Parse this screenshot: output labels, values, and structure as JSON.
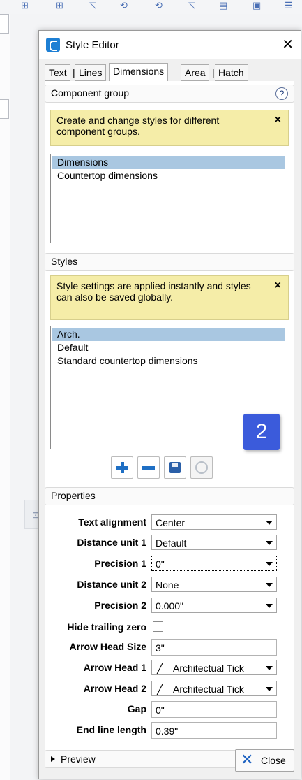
{
  "dialog": {
    "title": "Style Editor",
    "close_glyph": "✕"
  },
  "tabs": [
    {
      "label": "Text"
    },
    {
      "label": "Lines"
    },
    {
      "label": "Dimensions"
    },
    {
      "label": "Area"
    },
    {
      "label": "Hatch"
    }
  ],
  "tab_separator": "|",
  "component_group": {
    "heading": "Component group",
    "help_glyph": "?",
    "info": "Create and change styles for different component groups.",
    "info_close": "×",
    "items": [
      "Dimensions",
      "Countertop dimensions"
    ],
    "selected_index": 0
  },
  "styles": {
    "heading": "Styles",
    "info": "Style settings are applied instantly and styles can also be saved globally.",
    "info_close": "×",
    "items": [
      "Arch.",
      "Default",
      "Standard countertop dimensions"
    ],
    "selected_index": 0,
    "badge": "2"
  },
  "style_actions": [
    {
      "icon": "add-icon",
      "enabled": true
    },
    {
      "icon": "remove-icon",
      "enabled": true
    },
    {
      "icon": "save-icon",
      "enabled": true
    },
    {
      "icon": "global-sync-icon",
      "enabled": false
    }
  ],
  "properties": {
    "heading": "Properties",
    "text_alignment": {
      "label": "Text alignment",
      "value": "Center"
    },
    "distance_unit_1": {
      "label": "Distance unit 1",
      "value": "Default"
    },
    "precision_1": {
      "label": "Precision 1",
      "value": "0\""
    },
    "distance_unit_2": {
      "label": "Distance unit 2",
      "value": "None"
    },
    "precision_2": {
      "label": "Precision 2",
      "value": "0.000\""
    },
    "hide_trailing_zero": {
      "label": "Hide trailing zero",
      "checked": false
    },
    "arrow_head_size": {
      "label": "Arrow Head Size",
      "value": "3\""
    },
    "arrow_head_1": {
      "label": "Arrow Head 1",
      "value": "Architectual Tick",
      "icon": "tick-icon"
    },
    "arrow_head_2": {
      "label": "Arrow Head 2",
      "value": "Architectual Tick",
      "icon": "tick-icon"
    },
    "gap": {
      "label": "Gap",
      "value": "0\""
    },
    "end_line_length": {
      "label": "End line length",
      "value": "0.39\""
    }
  },
  "preview": {
    "label": "Preview"
  },
  "close_button": {
    "label": "Close",
    "icon_glyph": "✕"
  },
  "colors": {
    "accent": "#1f6fc4",
    "selection": "#a9c7e1",
    "info_bg": "#f5eda8",
    "badge": "#3b5bdb"
  }
}
